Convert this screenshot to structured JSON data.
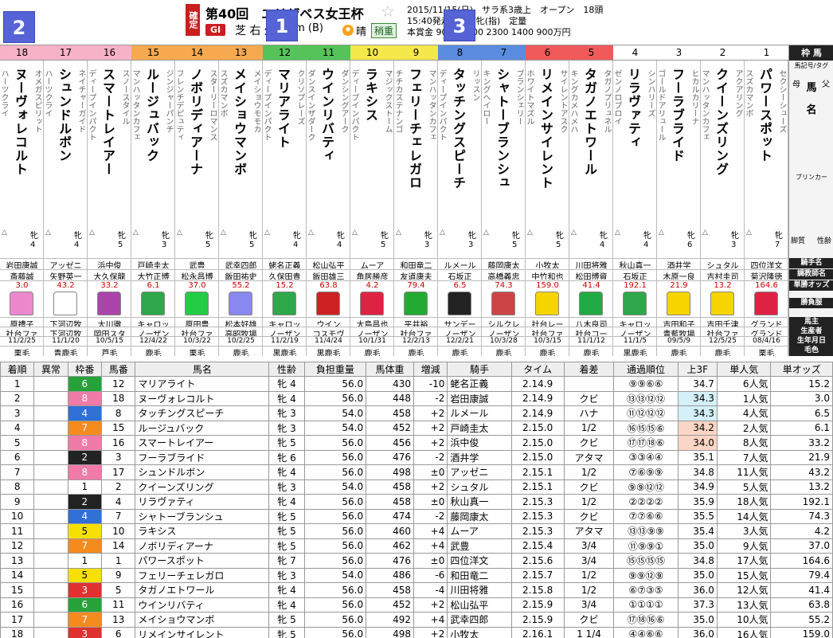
{
  "tags": {
    "t1": "1",
    "t2": "2",
    "t3": "3"
  },
  "header": {
    "kakutei": "確定",
    "title": "第40回　エリザベス女王杯",
    "grade": "GI",
    "surface": "芝 右 外",
    "distance": "2200m (B)",
    "weather": "晴",
    "going": "稍重",
    "info1": "2015/11/15(日)　サラ系3歳上　オープン　18頭",
    "info2": "15:40発走　国際牝(指)　定量",
    "info3": "本賞金 9000 3600 2300 1400 900万円"
  },
  "legend": {
    "waku": "枠 馬",
    "marker": "馬記号/タグ",
    "chichi": "父",
    "haha": "母",
    "uma": "馬",
    "mei": "名",
    "blinker": "ブリンカー",
    "seirei": "性齢",
    "kyakushitsu": "脚質",
    "jockey": "騎手名",
    "trainer": "調教師名",
    "odds": "単勝オッズ",
    "silk": "勝負服",
    "owner": "馬主",
    "breeder": "生産者",
    "dob": "生年月日",
    "coat": "毛色"
  },
  "card": [
    {
      "num": "18",
      "waku": "8",
      "color": "#f7b2c8",
      "name": "ヌーヴォレコルト",
      "sire": "ハーツクライ",
      "dam": "オメガスピリット",
      "sex": "牝4",
      "jockey": "岩田康誠",
      "trainer": "斎藤誠",
      "odds": "3.0",
      "silk": "#ee88cc",
      "owner": "原禮子",
      "breeder": "社台ファ",
      "dob": "11/2/25",
      "coat": "栗毛"
    },
    {
      "num": "17",
      "waku": "8",
      "color": "#f7b2c8",
      "name": "シュンドルボン",
      "sire": "ハーツクライ",
      "dam": "ネイチャーガイド",
      "sex": "牝4",
      "jockey": "アッゼニ",
      "trainer": "矢野英一",
      "odds": "43.2",
      "silk": "#ffffff",
      "owner": "下河辺牧",
      "breeder": "下河辺牧",
      "dob": "11/1/20",
      "coat": "青鹿毛"
    },
    {
      "num": "16",
      "waku": "8",
      "color": "#f7b2c8",
      "name": "スマートレイアー",
      "sire": "ディープインパクト",
      "dam": "スノースタイル",
      "sex": "牝5",
      "jockey": "浜中俊",
      "trainer": "大久保龍",
      "odds": "33.2",
      "silk": "#aa44aa",
      "owner": "大川徹",
      "breeder": "岡田スタ",
      "dob": "10/5/15",
      "coat": "芦毛"
    },
    {
      "num": "15",
      "waku": "7",
      "color": "#f7a950",
      "name": "ルージュバック",
      "sire": "マンハッタンカフェ",
      "dam": "ジンジャーパンチ",
      "sex": "牝3",
      "jockey": "戸崎圭太",
      "trainer": "大竹正博",
      "odds": "6.1",
      "silk": "#2ea84a",
      "owner": "キャロッ",
      "breeder": "ノーザン",
      "dob": "12/4/22",
      "coat": "鹿毛"
    },
    {
      "num": "14",
      "waku": "7",
      "color": "#f7a950",
      "name": "ノボリディアーナ",
      "sire": "フレンチデピュティ",
      "dam": "スターリーロマンス",
      "sex": "牝5",
      "jockey": "武豊",
      "trainer": "松永昌博",
      "odds": "37.0",
      "silk": "#22cc44",
      "owner": "原田豊",
      "breeder": "社台ファ",
      "dob": "10/3/22",
      "coat": "栗毛"
    },
    {
      "num": "13",
      "waku": "7",
      "color": "#f7a950",
      "name": "メイショウマンボ",
      "sire": "スズカマンボ",
      "dam": "メイショウモモカ",
      "sex": "牝5",
      "jockey": "武幸四郎",
      "trainer": "飯田祐史",
      "odds": "55.2",
      "silk": "#8888ee",
      "owner": "松本好雄",
      "breeder": "高昭牧場",
      "dob": "10/2/25",
      "coat": "鹿毛"
    },
    {
      "num": "12",
      "waku": "6",
      "color": "#55c35a",
      "name": "マリアライト",
      "sire": "ディープインパクト",
      "dam": "クリソプレーズ",
      "sex": "牝4",
      "jockey": "蛯名正義",
      "trainer": "久保田貴",
      "odds": "15.2",
      "silk": "#2ea84a",
      "owner": "キャロッ",
      "breeder": "ノーザン",
      "dob": "11/2/19",
      "coat": "黒鹿毛"
    },
    {
      "num": "11",
      "waku": "6",
      "color": "#55c35a",
      "name": "ウインリバティ",
      "sire": "ダンスインザダーク",
      "dam": "ダンシングアーク",
      "sex": "牝4",
      "jockey": "松山弘平",
      "trainer": "飯田雄三",
      "odds": "63.8",
      "silk": "#cc2222",
      "owner": "ウイン",
      "breeder": "コスモヴ",
      "dob": "11/4/24",
      "coat": "黒鹿毛"
    },
    {
      "num": "10",
      "waku": "5",
      "color": "#f5e84a",
      "name": "ラキシス",
      "sire": "ディープインパクト",
      "dam": "マジックストーム",
      "sex": "牝5",
      "jockey": "ムーア",
      "trainer": "角居勝彦",
      "odds": "4.2",
      "silk": "#dd2244",
      "owner": "大島昌也",
      "breeder": "ノーザン",
      "dob": "10/1/31",
      "coat": "鹿毛"
    },
    {
      "num": "9",
      "waku": "5",
      "color": "#f5e84a",
      "name": "フェリーチェレガロ",
      "sire": "チチカステナンゴ",
      "dam": "マンハッタンカフェ",
      "sex": "牝3",
      "jockey": "和田竜二",
      "trainer": "友道康夫",
      "odds": "79.4",
      "silk": "#22aa33",
      "owner": "平井裕",
      "breeder": "社台ファ",
      "dob": "12/2/13",
      "coat": "鹿毛"
    },
    {
      "num": "8",
      "waku": "4",
      "color": "#5a8de0",
      "name": "タッチングスピーチ",
      "sire": "ディープインパクト",
      "dam": "リッスン",
      "sex": "牝3",
      "jockey": "ルメール",
      "trainer": "石坂正",
      "odds": "6.5",
      "silk": "#222222",
      "owner": "サンデー",
      "breeder": "ノーザン",
      "dob": "12/2/21",
      "coat": "鹿毛"
    },
    {
      "num": "7",
      "waku": "4",
      "color": "#5a8de0",
      "name": "シャトーブランシュ",
      "sire": "キングヘイロー",
      "dam": "ブランシェリー",
      "sex": "牝5",
      "jockey": "藤岡康太",
      "trainer": "高橋義忠",
      "odds": "74.3",
      "silk": "#cc4444",
      "owner": "シルクレ",
      "breeder": "ノーザン",
      "dob": "10/3/28",
      "coat": "鹿毛"
    },
    {
      "num": "6",
      "waku": "3",
      "color": "#f05a5a",
      "name": "リメインサイレント",
      "sire": "ホワイトマズル",
      "dam": "サイレントアスク",
      "sex": "牝5",
      "jockey": "小牧太",
      "trainer": "中竹和也",
      "odds": "159.0",
      "silk": "#f5d400",
      "owner": "社台レー",
      "breeder": "社台ファ",
      "dob": "10/3/15",
      "coat": "鹿毛"
    },
    {
      "num": "5",
      "waku": "3",
      "color": "#f05a5a",
      "name": "タガノエトワール",
      "sire": "キングカメハメハ",
      "dam": "タガノプリュネル",
      "sex": "牝4",
      "jockey": "川田将雅",
      "trainer": "松田博資",
      "odds": "41.4",
      "silk": "#22aa44",
      "owner": "八木良司",
      "breeder": "社台コー",
      "dob": "11/1/12",
      "coat": "鹿毛"
    },
    {
      "num": "4",
      "waku": "2",
      "color": "#ffffff",
      "name": "リラヴァティ",
      "sire": "ゼンノロブロイ",
      "dam": "シンハリーズ",
      "sex": "牝4",
      "jockey": "秋山真一",
      "trainer": "石坂正",
      "odds": "192.1",
      "silk": "#2ea84a",
      "owner": "キャロッ",
      "breeder": "ノーザン",
      "dob": "11/1/5",
      "coat": "黒鹿毛"
    },
    {
      "num": "3",
      "waku": "2",
      "color": "#ffffff",
      "name": "フーラブライド",
      "sire": "ゴールドアリュール",
      "dam": "ヒカルカリーナ",
      "sex": "牝6",
      "jockey": "酒井学",
      "trainer": "木原一良",
      "odds": "21.9",
      "silk": "#f5d400",
      "owner": "吉田和子",
      "breeder": "青藍牧場",
      "dob": "09/5/9",
      "coat": "鹿毛"
    },
    {
      "num": "2",
      "waku": "1",
      "color": "#ffffff",
      "name": "クイーンズリング",
      "sire": "マンハッタンカフェ",
      "dam": "アクアリング",
      "sex": "牝3",
      "jockey": "シュタル",
      "trainer": "吉村圭司",
      "odds": "13.2",
      "silk": "#f5d400",
      "owner": "吉田千津",
      "breeder": "社台ファ",
      "dob": "12/5/25",
      "coat": "鹿毛"
    },
    {
      "num": "1",
      "waku": "1",
      "color": "#ffffff",
      "name": "パワースポット",
      "sire": "スズカマンボ",
      "dam": "セクシーシューズ",
      "sex": "牝7",
      "jockey": "四位洋文",
      "trainer": "菊沢隆徳",
      "odds": "164.6",
      "silk": "#dd2244",
      "owner": "グランド",
      "breeder": "グランド",
      "dob": "08/4/16",
      "coat": "栗毛"
    }
  ],
  "results": {
    "headers": [
      "着順",
      "異常",
      "枠番",
      "馬番",
      "馬名",
      "性齢",
      "負担重量",
      "馬体重",
      "増減",
      "騎手",
      "タイム",
      "着差",
      "通過順位",
      "上3F",
      "単人気",
      "単オッズ"
    ],
    "rows": [
      [
        "1",
        "",
        "6",
        "12",
        "マリアライト",
        "牝 4",
        "56.0",
        "430",
        "-10",
        "蛯名正義",
        "2.14.9",
        "",
        "⑨⑨⑥⑥",
        "34.7",
        "6人気",
        "15.2"
      ],
      [
        "2",
        "",
        "8",
        "18",
        "ヌーヴォレコルト",
        "牝 4",
        "56.0",
        "448",
        "-2",
        "岩田康誠",
        "2.14.9",
        "クビ",
        "⑬⑬⑫⑫",
        "34.3",
        "1人気",
        "3.0"
      ],
      [
        "3",
        "",
        "4",
        "8",
        "タッチングスピーチ",
        "牝 3",
        "54.0",
        "458",
        "+2",
        "ルメール",
        "2.14.9",
        "ハナ",
        "⑪⑫⑫⑫",
        "34.3",
        "4人気",
        "6.5"
      ],
      [
        "4",
        "",
        "7",
        "15",
        "ルージュバック",
        "牝 3",
        "54.0",
        "452",
        "+2",
        "戸崎圭太",
        "2.15.0",
        "1/2",
        "⑯⑮⑮⑥",
        "34.2",
        "2人気",
        "6.1"
      ],
      [
        "5",
        "",
        "8",
        "16",
        "スマートレイアー",
        "牝 5",
        "56.0",
        "456",
        "+2",
        "浜中俊",
        "2.15.0",
        "クビ",
        "⑰⑰⑱⑥",
        "34.0",
        "8人気",
        "33.2"
      ],
      [
        "6",
        "",
        "2",
        "3",
        "フーラブライド",
        "牝 6",
        "56.0",
        "476",
        "-2",
        "酒井学",
        "2.15.0",
        "アタマ",
        "③③④④",
        "35.1",
        "7人気",
        "21.9"
      ],
      [
        "7",
        "",
        "8",
        "17",
        "シュンドルボン",
        "牝 4",
        "56.0",
        "498",
        "±0",
        "アッゼニ",
        "2.15.1",
        "1/2",
        "⑦⑥⑨⑨",
        "34.8",
        "11人気",
        "43.2"
      ],
      [
        "8",
        "",
        "1",
        "2",
        "クイーンズリング",
        "牝 3",
        "54.0",
        "458",
        "+2",
        "シュタル",
        "2.15.1",
        "クビ",
        "⑨⑨⑫⑫",
        "34.9",
        "5人気",
        "13.2"
      ],
      [
        "9",
        "",
        "2",
        "4",
        "リラヴァティ",
        "牝 4",
        "56.0",
        "458",
        "±0",
        "秋山真一",
        "2.15.3",
        "1/2",
        "②②②②",
        "35.9",
        "18人気",
        "192.1"
      ],
      [
        "10",
        "",
        "4",
        "7",
        "シャトーブランシュ",
        "牝 5",
        "56.0",
        "474",
        "-2",
        "藤岡康太",
        "2.15.3",
        "クビ",
        "⑦⑦⑥⑥",
        "35.5",
        "14人気",
        "74.3"
      ],
      [
        "11",
        "",
        "5",
        "10",
        "ラキシス",
        "牝 5",
        "56.0",
        "460",
        "+4",
        "ムーア",
        "2.15.3",
        "アタマ",
        "⑬⑬⑨⑨",
        "35.4",
        "3人気",
        "4.2"
      ],
      [
        "12",
        "",
        "7",
        "14",
        "ノボリディアーナ",
        "牝 5",
        "56.0",
        "462",
        "+4",
        "武豊",
        "2.15.4",
        "3/4",
        "⑪⑨⑨①",
        "35.0",
        "9人気",
        "37.0"
      ],
      [
        "13",
        "",
        "1",
        "1",
        "パワースポット",
        "牝 7",
        "56.0",
        "476",
        "±0",
        "四位洋文",
        "2.15.6",
        "3/4",
        "⑮⑮⑮⑮",
        "34.8",
        "17人気",
        "164.6"
      ],
      [
        "14",
        "",
        "5",
        "9",
        "フェリーチェレガロ",
        "牝 3",
        "54.0",
        "486",
        "-6",
        "和田竜二",
        "2.15.7",
        "1/2",
        "⑨⑨⑫⑨",
        "35.0",
        "15人気",
        "79.4"
      ],
      [
        "15",
        "",
        "3",
        "5",
        "タガノエトワール",
        "牝 4",
        "56.0",
        "458",
        "-4",
        "川田将雅",
        "2.15.8",
        "1/2",
        "⑥⑦③⑤",
        "36.0",
        "12人気",
        "41.4"
      ],
      [
        "16",
        "",
        "6",
        "11",
        "ウインリバティ",
        "牝 4",
        "56.0",
        "452",
        "+2",
        "松山弘平",
        "2.15.9",
        "3/4",
        "①①①①",
        "37.3",
        "13人気",
        "63.8"
      ],
      [
        "17",
        "",
        "7",
        "13",
        "メイショウマンボ",
        "牝 5",
        "56.0",
        "492",
        "+4",
        "武幸四郎",
        "2.15.9",
        "クビ",
        "⑰⑱⑯⑥",
        "35.0",
        "10人気",
        "55.2"
      ],
      [
        "18",
        "",
        "3",
        "6",
        "リメインサイレント",
        "牝 5",
        "56.0",
        "498",
        "+2",
        "小牧太",
        "2.16.1",
        "1 1/4",
        "④④⑥⑥",
        "36.0",
        "16人気",
        "159.0"
      ]
    ]
  },
  "waku_colors": {
    "1": "#ffffff",
    "2": "#222222",
    "3": "#e03030",
    "4": "#2f6fd6",
    "5": "#f5e000",
    "6": "#27a23a",
    "7": "#f58a1f",
    "8": "#f07aa8"
  },
  "highlight": {
    "last3f_best": "#fbd5c5",
    "last3f_second": "#d4f0f8"
  }
}
